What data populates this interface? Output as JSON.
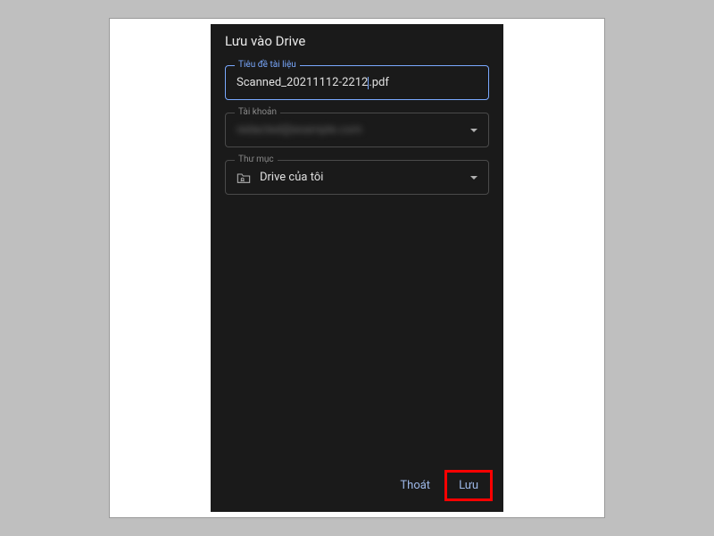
{
  "dialog": {
    "title": "Lưu vào Drive",
    "title_field": {
      "label": "Tiêu đề tài liệu",
      "value_pre": "Scanned_20211112-2212",
      "value_post": ".pdf"
    },
    "account_field": {
      "label": "Tài khoản",
      "value": "redacted@example.com"
    },
    "folder_field": {
      "label": "Thư mục",
      "value": "Drive của tôi"
    }
  },
  "footer": {
    "cancel_label": "Thoát",
    "save_label": "Lưu"
  }
}
